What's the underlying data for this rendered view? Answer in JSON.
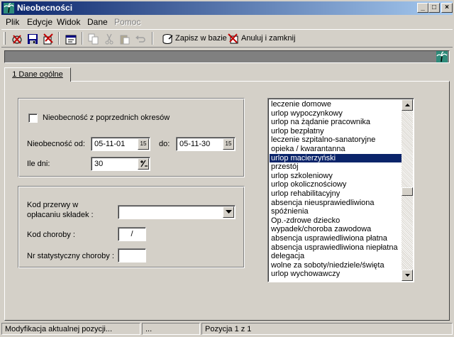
{
  "window": {
    "title": "Nieobecności",
    "controls": {
      "minimize": "_",
      "maximize": "□",
      "close": "×"
    }
  },
  "menu": [
    {
      "label": "Plik",
      "enabled": true
    },
    {
      "label": "Edycje",
      "enabled": true
    },
    {
      "label": "Widok",
      "enabled": true
    },
    {
      "label": "Dane",
      "enabled": true
    },
    {
      "label": "Pomoc",
      "enabled": false
    }
  ],
  "toolbar": {
    "icons": [
      "delete-icon",
      "save-icon",
      "cut-record-icon",
      "properties-icon",
      "copy-icon",
      "cut-icon",
      "paste-icon",
      "undo-icon"
    ],
    "save_label": "Zapisz w bazie",
    "cancel_label": "Anuluj i zamknij"
  },
  "tabs": [
    {
      "label": "1 Dane ogólne",
      "active": true
    }
  ],
  "form": {
    "prev_periods_label": "Nieobecność z poprzednich okresów",
    "prev_periods_checked": false,
    "from_label": "Nieobecność od:",
    "from_value": "05-11-01",
    "to_label": "do:",
    "to_value": "05-11-30",
    "days_label": "Ile dni:",
    "days_value": "30",
    "date_btn": "15",
    "kod_przerwy_label_1": "Kod przerwy w",
    "kod_przerwy_label_2": "opłacaniu składek :",
    "kod_przerwy_value": "",
    "kod_choroby_label": "Kod choroby :",
    "kod_choroby_value": "/",
    "nr_stat_label": "Nr statystyczny choroby :",
    "nr_stat_value": ""
  },
  "absence_types": [
    "leczenie domowe",
    "urlop wypoczynkowy",
    "urlop na żądanie pracownika",
    "urlop bezpłatny",
    "leczenie szpitalno-sanatoryjne",
    "opieka / kwarantanna",
    "urlop macierzyński",
    "przestój",
    "urlop szkoleniowy",
    "urlop okolicznościowy",
    "urlop rehabilitacyjny",
    "absencja nieusprawiedliwiona",
    "spóźnienia",
    "Op.-zdrowe dziecko",
    "wypadek/choroba zawodowa",
    "absencja usprawiedliwiona płatna",
    "absencja usprawiedliwiona niepłatna",
    "delegacja",
    "wolne za soboty/niedziele/święta",
    "urlop wychowawczy"
  ],
  "absence_selected_index": 6,
  "status": {
    "message": "Modyfikacja aktualnej pozycji...",
    "dots": "...",
    "position": "Pozycja 1 z 1"
  }
}
